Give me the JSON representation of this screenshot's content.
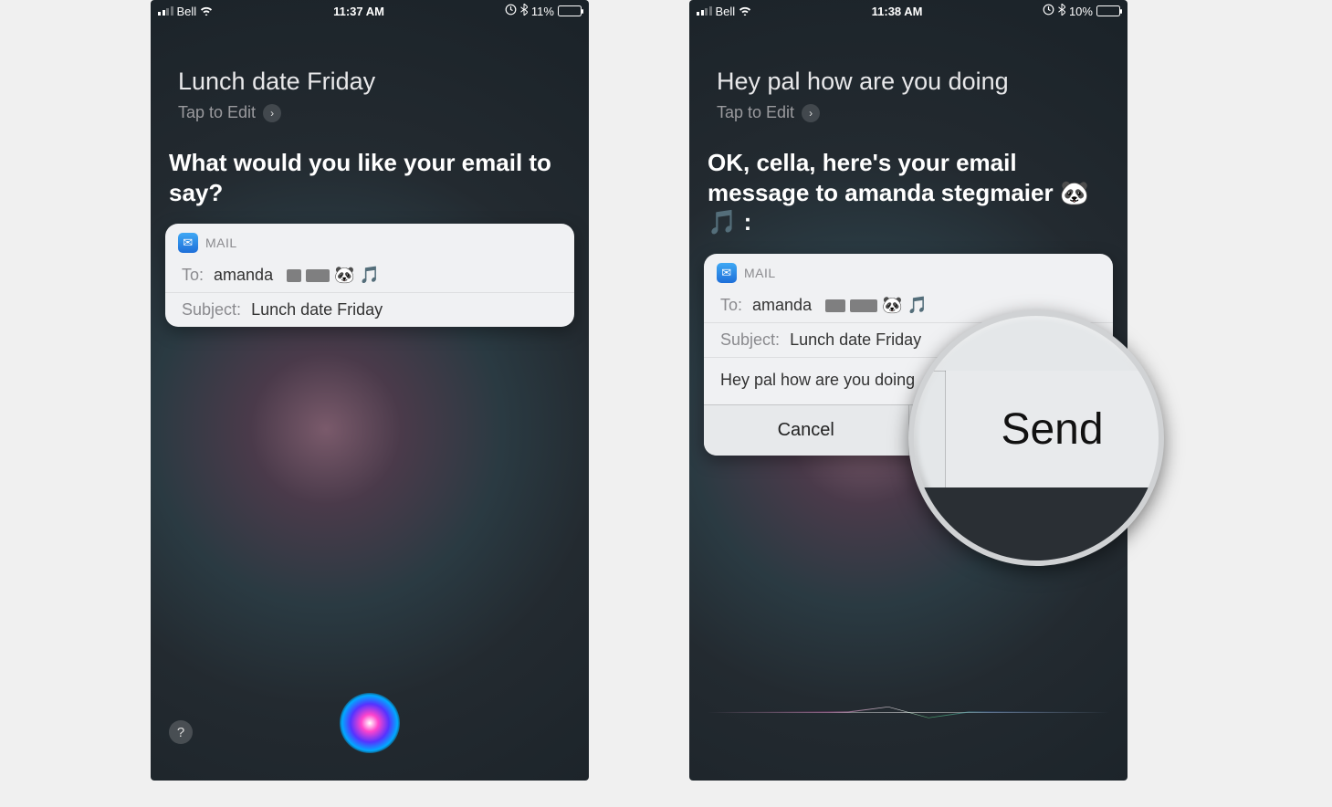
{
  "left": {
    "status": {
      "carrier": "Bell",
      "time": "11:37 AM",
      "battery_pct": "11%"
    },
    "utterance": "Lunch date Friday",
    "tap_to_edit": "Tap to Edit",
    "siri_prompt": "What would you like your email to say?",
    "mail": {
      "app_label": "MAIL",
      "to_label": "To:",
      "to_value": "amanda",
      "to_suffix": "🐼 🎵",
      "subject_label": "Subject:",
      "subject_value": "Lunch date Friday"
    },
    "help_label": "?"
  },
  "right": {
    "status": {
      "carrier": "Bell",
      "time": "11:38 AM",
      "battery_pct": "10%"
    },
    "utterance": "Hey pal how are you doing",
    "tap_to_edit": "Tap to Edit",
    "siri_prompt": "OK, cella, here's your email message to amanda stegmaier 🐼 🎵 :",
    "mail": {
      "app_label": "MAIL",
      "to_label": "To:",
      "to_value": "amanda",
      "to_suffix": "🐼 🎵",
      "subject_label": "Subject:",
      "subject_value": "Lunch date Friday",
      "body": "Hey pal how are you doing",
      "cancel": "Cancel",
      "send": "Send"
    },
    "magnifier_label": "Send"
  }
}
